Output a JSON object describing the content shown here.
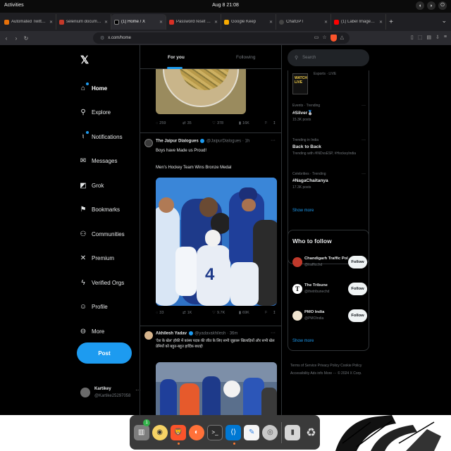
{
  "system": {
    "activities": "Activities",
    "clock": "Aug 8  21:08"
  },
  "browser": {
    "tabs": [
      {
        "label": "Automated Twitter Scrolling",
        "color": "#e8710a"
      },
      {
        "label": "selenium documentation - ",
        "color": "#c53929"
      },
      {
        "label": "(1) Home / X",
        "color": "#000000"
      },
      {
        "label": "Password reset request - ba",
        "color": "#d93025"
      },
      {
        "label": "Google Keep",
        "color": "#f9ab00"
      },
      {
        "label": "ChatGPT",
        "color": "#444444"
      },
      {
        "label": "(1) Label Images for Object",
        "color": "#ff0000"
      }
    ],
    "active_tab_index": 2,
    "url": "x.com/home"
  },
  "x": {
    "nav": [
      {
        "label": "Home",
        "icon": "home-icon",
        "glyph": "⌂"
      },
      {
        "label": "Explore",
        "icon": "search-icon",
        "glyph": "⚲"
      },
      {
        "label": "Notifications",
        "icon": "bell-icon",
        "glyph": "♫"
      },
      {
        "label": "Messages",
        "icon": "envelope-icon",
        "glyph": "✉"
      },
      {
        "label": "Grok",
        "icon": "grok-icon",
        "glyph": "◩"
      },
      {
        "label": "Bookmarks",
        "icon": "bookmark-icon",
        "glyph": "⚑"
      },
      {
        "label": "Communities",
        "icon": "communities-icon",
        "glyph": "⚇"
      },
      {
        "label": "Premium",
        "icon": "x-premium-icon",
        "glyph": "✕"
      },
      {
        "label": "Verified Orgs",
        "icon": "lightning-icon",
        "glyph": "ϟ"
      },
      {
        "label": "Profile",
        "icon": "person-icon",
        "glyph": "☺"
      },
      {
        "label": "More",
        "icon": "more-circle-icon",
        "glyph": "⋯"
      }
    ],
    "post_label": "Post",
    "account": {
      "name": "Kartikey",
      "handle": "@Kartike25297058"
    },
    "timeline_tabs": [
      "For you",
      "Following"
    ],
    "prev_actions": {
      "reply": "259",
      "repost": "35",
      "like": "378",
      "views": "16K"
    },
    "tweets": [
      {
        "name": "The Jaipur Dialogues",
        "handle": "@JaipurDialogues · 1h",
        "text1": "Boys have Made us Proud!",
        "text2": "Men's Hockey Team Wins Bronze Medal",
        "actions": {
          "reply": "33",
          "repost": "1K",
          "like": "9.7K",
          "views": "69K"
        }
      },
      {
        "name": "Akhilesh Yadav",
        "handle": "@yadavakhilesh · 36m",
        "text1": "'देश के खेल' हॉकी में कांस्य पदक की जीत के लिए सभी जुझारू खिलाड़ियों और सभी खेल प्रेमियों को बहुत-बहुत हार्दिक बधाई!"
      }
    ],
    "search_placeholder": "Search",
    "live": {
      "badge": "WATCH LIVE",
      "meta": "Esports · LIVE"
    },
    "trends": [
      {
        "category": "Events · Trending",
        "name": "#Silver🥈",
        "posts": "15.3K posts"
      },
      {
        "category": "Trending in India",
        "name": "Back to Back",
        "links": "Trending with #INDvsESP, #HockeyIndia"
      },
      {
        "category": "Celebrities · Trending",
        "name": "#NagaChaitanya",
        "posts": "17.3K posts"
      }
    ],
    "show_more": "Show more",
    "who_to_follow": "Who to follow",
    "follow": [
      {
        "name": "Chandigarh Traffic Police",
        "handle": "@trafficchd",
        "color": "#c0392b"
      },
      {
        "name": "The Tribune",
        "handle": "@thetribunechd",
        "color": "#ffffff"
      },
      {
        "name": "PMO India",
        "handle": "@PMOIndia",
        "color": "#f0e4d0"
      }
    ],
    "follow_label": "Follow",
    "footer": "Terms of Service  Privacy Policy  Cookie Policy  Accessibility  Ads info  More ···  © 2024 X Corp."
  },
  "dock": {
    "badge_count": "1",
    "apps": [
      "files-icon",
      "rhythmbox-icon",
      "brave-icon",
      "firefox-icon",
      "terminal-icon",
      "vscode-icon",
      "text-editor-icon",
      "disks-icon",
      "usb-drive-icon",
      "trash-icon"
    ]
  }
}
